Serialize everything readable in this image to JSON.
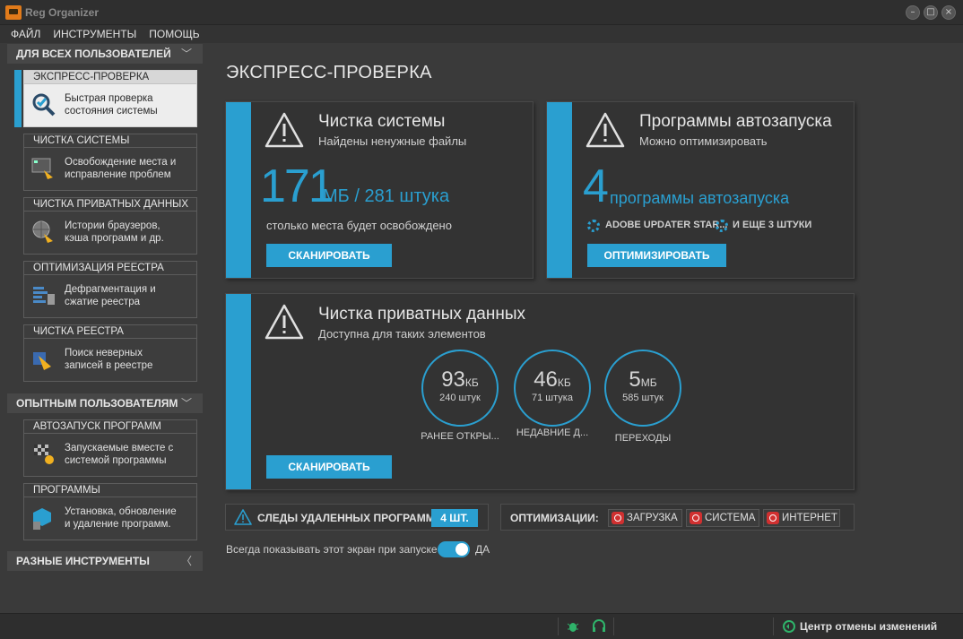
{
  "window": {
    "title": "Reg Organizer"
  },
  "menu": {
    "items": [
      "ФАЙЛ",
      "ИНСТРУМЕНТЫ",
      "ПОМОЩЬ"
    ]
  },
  "sidebar": {
    "sections": [
      {
        "title": "ДЛЯ ВСЕХ ПОЛЬЗОВАТЕЛЕЙ",
        "expanded": true
      },
      {
        "title": "ОПЫТНЫМ ПОЛЬЗОВАТЕЛЯМ",
        "expanded": true
      },
      {
        "title": "РАЗНЫЕ ИНСТРУМЕНТЫ",
        "expanded": false
      }
    ],
    "items": [
      {
        "title": "ЭКСПРЕСС-ПРОВЕРКА",
        "line1": "Быстрая проверка",
        "line2": "состояния системы",
        "icon": "magnifier-check-icon",
        "active": true
      },
      {
        "title": "ЧИСТКА СИСТЕМЫ",
        "line1": "Освобождение места и",
        "line2": "исправление проблем",
        "icon": "monitor-broom-icon"
      },
      {
        "title": "ЧИСТКА ПРИВАТНЫХ ДАННЫХ",
        "line1": "Истории браузеров,",
        "line2": "кэша программ и др.",
        "icon": "globe-broom-icon"
      },
      {
        "title": "ОПТИМИЗАЦИЯ РЕЕСТРА",
        "line1": "Дефрагментация и",
        "line2": "сжатие реестра",
        "icon": "registry-defrag-icon"
      },
      {
        "title": "ЧИСТКА РЕЕСТРА",
        "line1": "Поиск неверных",
        "line2": "записей в реестре",
        "icon": "registry-broom-icon"
      },
      {
        "title": "АВТОЗАПУСК ПРОГРАММ",
        "line1": "Запускаемые вместе с",
        "line2": "системой программы",
        "icon": "flag-gear-icon"
      },
      {
        "title": "ПРОГРАММЫ",
        "line1": "Установка, обновление",
        "line2": "и удаление программ.",
        "icon": "box-trash-icon"
      }
    ]
  },
  "main": {
    "title": "ЭКСПРЕСС-ПРОВЕРКА",
    "system_clean": {
      "title": "Чистка системы",
      "subtitle": "Найдены ненужные файлы",
      "amount": "171",
      "amount_unit": "МБ / 281 штука",
      "note": "столько места будет освобождено",
      "button": "СКАНИРОВАТЬ"
    },
    "autostart": {
      "title": "Программы автозапуска",
      "subtitle": "Можно оптимизировать",
      "count": "4",
      "count_unit": "программы автозапуска",
      "item1": "ADOBE UPDATER STAR...",
      "item2": "И ЕЩЕ 3 ШТУКИ",
      "button": "ОПТИМИЗИРОВАТЬ"
    },
    "private": {
      "title": "Чистка приватных данных",
      "subtitle": "Доступна для таких элементов",
      "circles": [
        {
          "value": "93",
          "unit": "КБ",
          "count": "240 штук",
          "label": "РАНЕЕ ОТКРЫ..."
        },
        {
          "value": "46",
          "unit": "КБ",
          "count": "71 штука",
          "label": "НЕДАВНИЕ Д..."
        },
        {
          "value": "5",
          "unit": "МБ",
          "count": "585 штук",
          "label": "ПЕРЕХОДЫ"
        }
      ],
      "button": "СКАНИРОВАТЬ"
    },
    "leftovers": {
      "label": "СЛЕДЫ УДАЛЕННЫХ ПРОГРАММ",
      "badge": "4 ШТ."
    },
    "optimizations": {
      "label": "ОПТИМИЗАЦИИ:",
      "buttons": [
        "ЗАГРУЗКА",
        "СИСТЕМА",
        "ИНТЕРНЕТ"
      ]
    },
    "startup_toggle": {
      "label": "Всегда показывать этот экран при запуске",
      "value": "ДА"
    }
  },
  "status": {
    "undo_center": "Центр отмены изменений"
  },
  "colors": {
    "accent": "#2a9fd0",
    "background": "#3a3a3a",
    "panel": "#333333"
  }
}
